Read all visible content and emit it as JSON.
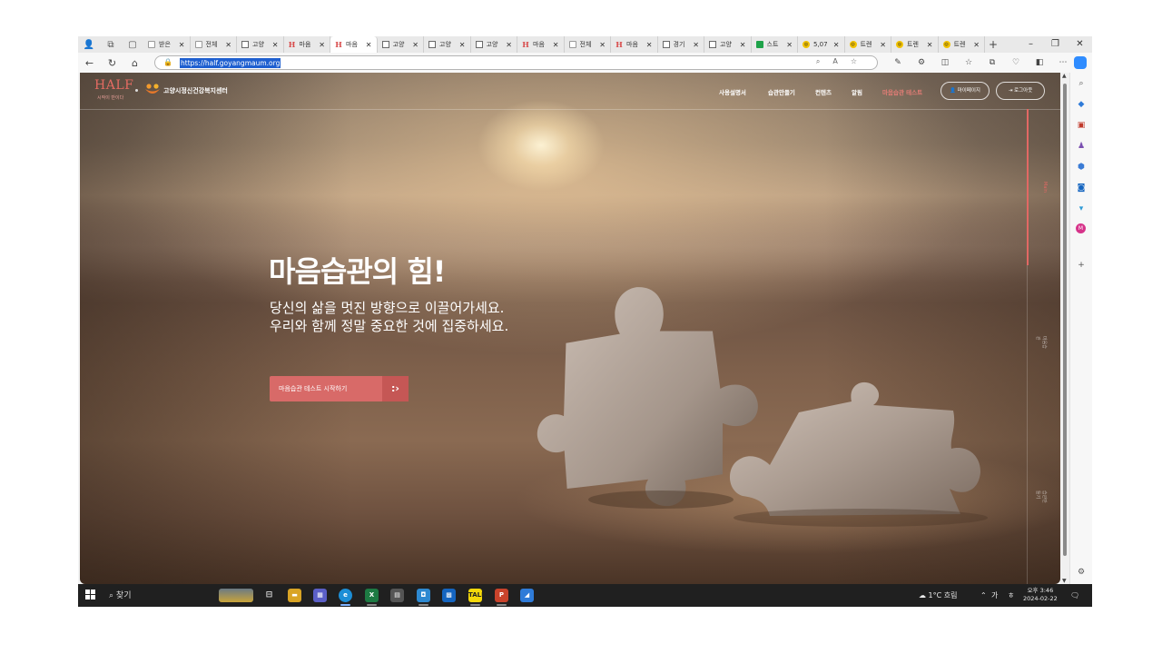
{
  "browser": {
    "tabs": [
      {
        "icon": "mail",
        "title": "받은"
      },
      {
        "icon": "mail",
        "title": "전체"
      },
      {
        "icon": "doc",
        "title": "고양"
      },
      {
        "icon": "half",
        "title": "마음"
      },
      {
        "icon": "half",
        "title": "마음",
        "active": true
      },
      {
        "icon": "doc",
        "title": "고양"
      },
      {
        "icon": "doc",
        "title": "고양"
      },
      {
        "icon": "doc",
        "title": "고양"
      },
      {
        "icon": "half",
        "title": "마음"
      },
      {
        "icon": "mail",
        "title": "전체"
      },
      {
        "icon": "half",
        "title": "마음"
      },
      {
        "icon": "doc",
        "title": "경기"
      },
      {
        "icon": "doc",
        "title": "고양"
      },
      {
        "icon": "sheet",
        "title": "스트"
      },
      {
        "icon": "circle",
        "title": "5,07"
      },
      {
        "icon": "circle",
        "title": "트렌"
      },
      {
        "icon": "circle",
        "title": "트렌"
      },
      {
        "icon": "circle",
        "title": "트렌"
      }
    ],
    "url": "https://half.goyangmaum.org"
  },
  "site": {
    "logo": "HALF",
    "logo_tagline": "시작이 반이다",
    "center_name": "고양시정신건강복지센터",
    "menu": [
      "사용설명서",
      "습관만들기",
      "컨텐츠",
      "알림",
      "마음습관 테스트"
    ],
    "mypage_button": "마이페이지",
    "logout_button": "로그아웃",
    "hero_title": "마음습관의 힘!",
    "hero_line1": "당신의 삶을 멋진 방향으로 이끌어가세요.",
    "hero_line2": "우리와 함께 정말 중요한 것에 집중하세요.",
    "cta_label": "마음습관 테스트 시작하기",
    "side_indicator": [
      "Main",
      "마음습관",
      "습관만들기"
    ]
  },
  "taskbar": {
    "search_label": "찾기",
    "weather": "1°C 흐림",
    "ime_label": "가",
    "time": "오후 3:46",
    "date": "2024-02-22"
  },
  "colors": {
    "accent": "#d86a68",
    "logo": "#e46b62",
    "active_menu": "#e57d76"
  }
}
